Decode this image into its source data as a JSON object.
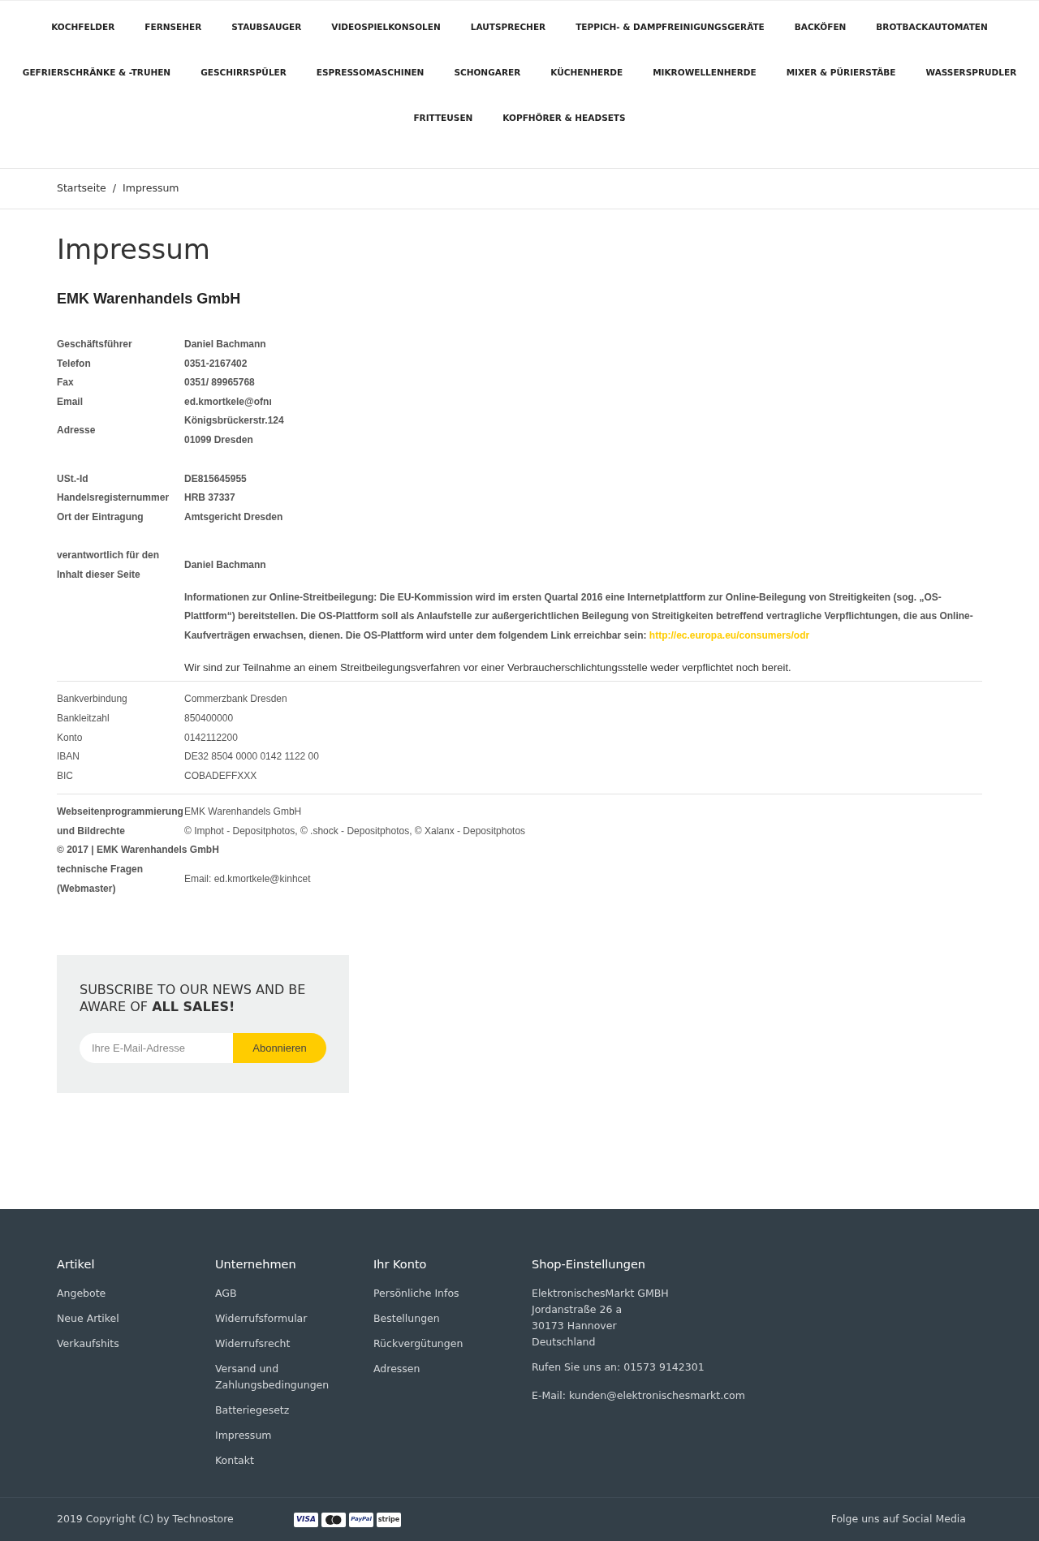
{
  "nav": {
    "rows": [
      {
        "links": [
          "KOCHFELDER",
          "FERNSEHER",
          "STAUBSAUGER",
          "VIDEOSPIELKONSOLEN",
          "LAUTSPRECHER",
          "TEPPICH- & DAMPFREINIGUNGSGERÄTE",
          "BACKÖFEN",
          "BROTBACKAUTOMATEN"
        ]
      },
      {
        "links": [
          "GEFRIERSCHRÄNKE & -TRUHEN",
          "GESCHIRRSPÜLER",
          "ESPRESSOMASCHINEN",
          "SCHONGARER",
          "KÜCHENHERDE",
          "MIKROWELLENHERDE",
          "MIXER & PÜRIERSTÄBE",
          "WASSERSPRUDLER"
        ]
      },
      {
        "links": [
          "FRITTEUSEN",
          "KOPFHÖRER & HEADSETS"
        ]
      }
    ]
  },
  "breadcrumb": {
    "items": [
      "Startseite",
      "Impressum"
    ],
    "separator": "/"
  },
  "page": {
    "title": "Impressum",
    "company": "EMK Warenhandels GmbH"
  },
  "impressum": [
    {
      "kind": "spaced",
      "label_bold": true,
      "value_bold": true,
      "rows": [
        {
          "label": [
            "Geschäftsführer"
          ],
          "value": [
            "Daniel Bachmann"
          ]
        },
        {
          "label": [
            "Telefon"
          ],
          "value": [
            "0351-2167402"
          ]
        },
        {
          "label": [
            "Fax"
          ],
          "value": [
            "0351/ 89965768"
          ]
        },
        {
          "label": [
            "Email"
          ],
          "value": [
            "ed.kmortkele@ofnı"
          ]
        },
        {
          "label": [
            "Adresse"
          ],
          "value": [
            "Königsbrückerstr.124",
            "01099 Dresden"
          ]
        }
      ]
    },
    {
      "kind": "spaced",
      "label_bold": true,
      "value_bold": true,
      "rows": [
        {
          "label": [
            "USt.-Id"
          ],
          "value": [
            "DE815645955"
          ]
        },
        {
          "label": [
            "Handelsregisternummer"
          ],
          "value": [
            "HRB 37337"
          ]
        },
        {
          "label": [
            "Ort der Eintragung"
          ],
          "value": [
            "Amtsgericht Dresden"
          ]
        }
      ]
    },
    {
      "kind": "spaced",
      "label_bold": true,
      "value_bold": true,
      "rows": [
        {
          "label": [
            "verantwortlich für den",
            "Inhalt dieser Seite"
          ],
          "value": [
            "Daniel Bachmann"
          ]
        }
      ],
      "notice": {
        "text": "Informationen zur Online-Streitbeilegung: Die EU-Kommission wird im ersten Quartal 2016 eine Internetplattform zur Online-Beilegung von Streitigkeiten (sog. „OS-Plattform“) bereitstellen. Die OS-Plattform soll als Anlaufstelle zur außergerichtlichen Beilegung von Streitigkeiten betreffend vertragliche Verpflichtungen, die aus Online-Kaufverträgen erwachsen, dienen. Die OS-Plattform wird unter dem folgendem Link erreichbar sein:",
        "link": "http://ec.europa.eu/consumers/odr",
        "closing": "Wir sind zur Teilnahme an einem Streitbeilegungsverfahren vor einer Verbraucherschlichtungsstelle weder verpflichtet noch bereit."
      }
    },
    {
      "kind": "ruled",
      "label_bold": false,
      "value_bold": false,
      "rows": [
        {
          "label": [
            "Bankverbindung"
          ],
          "value": [
            "Commerzbank Dresden"
          ]
        },
        {
          "label": [
            "Bankleitzahl"
          ],
          "value": [
            "850400000"
          ]
        },
        {
          "label": [
            "Konto"
          ],
          "value": [
            "0142112200"
          ]
        },
        {
          "label": [
            "IBAN"
          ],
          "value": [
            "DE32 8504 0000 0142 1122 00"
          ]
        },
        {
          "label": [
            "BIC"
          ],
          "value": [
            "COBADEFFXXX"
          ]
        }
      ]
    },
    {
      "kind": "ruled",
      "label_bold": true,
      "value_bold": false,
      "rows": [
        {
          "label": [
            "Webseitenprogrammierung",
            "und Bildrechte"
          ],
          "value": [
            "EMK Warenhandels GmbH",
            "© Imphot - Depositphotos, © .shock - Depositphotos, © Xalanx - Depositphotos"
          ]
        },
        {
          "label": [
            "© 2017 | EMK Warenhandels GmbH"
          ]
        },
        {
          "label": [
            "technische Fragen",
            "(Webmaster)"
          ],
          "value": [
            "Email: ed.kmortkele@kinhcet"
          ]
        }
      ]
    }
  ],
  "newsletter": {
    "title": "SUBSCRIBE TO OUR NEWS AND BE AWARE OF **ALL SALES!**",
    "placeholder": "Ihre E-Mail-Adresse",
    "button": "Abonnieren"
  },
  "footer": {
    "columns": [
      {
        "heading": "Artikel",
        "links": [
          "Angebote",
          "Neue Artikel",
          "Verkaufshits"
        ]
      },
      {
        "heading": "Unternehmen",
        "links": [
          "AGB",
          "Widerrufsformular",
          "Widerrufsrecht",
          "Versand und Zahlungsbedingungen",
          "Batteriegesetz",
          "Impressum",
          "Kontakt"
        ]
      },
      {
        "heading": "Ihr Konto",
        "links": [
          "Persönliche Infos",
          "Bestellungen",
          "Rückvergütungen",
          "Adressen"
        ]
      }
    ],
    "shop": {
      "heading": "Shop-Einstellungen",
      "address": [
        "ElektronischesMarkt GMBH",
        "Jordanstraße 26 a",
        "30173 Hannover",
        "Deutschland"
      ],
      "phone": "Rufen Sie uns an: 01573 9142301",
      "email": "E-Mail: kunden@elektronischesmarkt.com"
    },
    "copyright": "2019 Copyright (C) by Technostore",
    "payments": [
      {
        "kind": "visa",
        "text": "VISA"
      },
      {
        "kind": "mastercard"
      },
      {
        "kind": "paypal",
        "text": "PayPal"
      },
      {
        "kind": "stripe",
        "text": "stripe"
      }
    ],
    "social": "Folge uns auf Social Media"
  }
}
